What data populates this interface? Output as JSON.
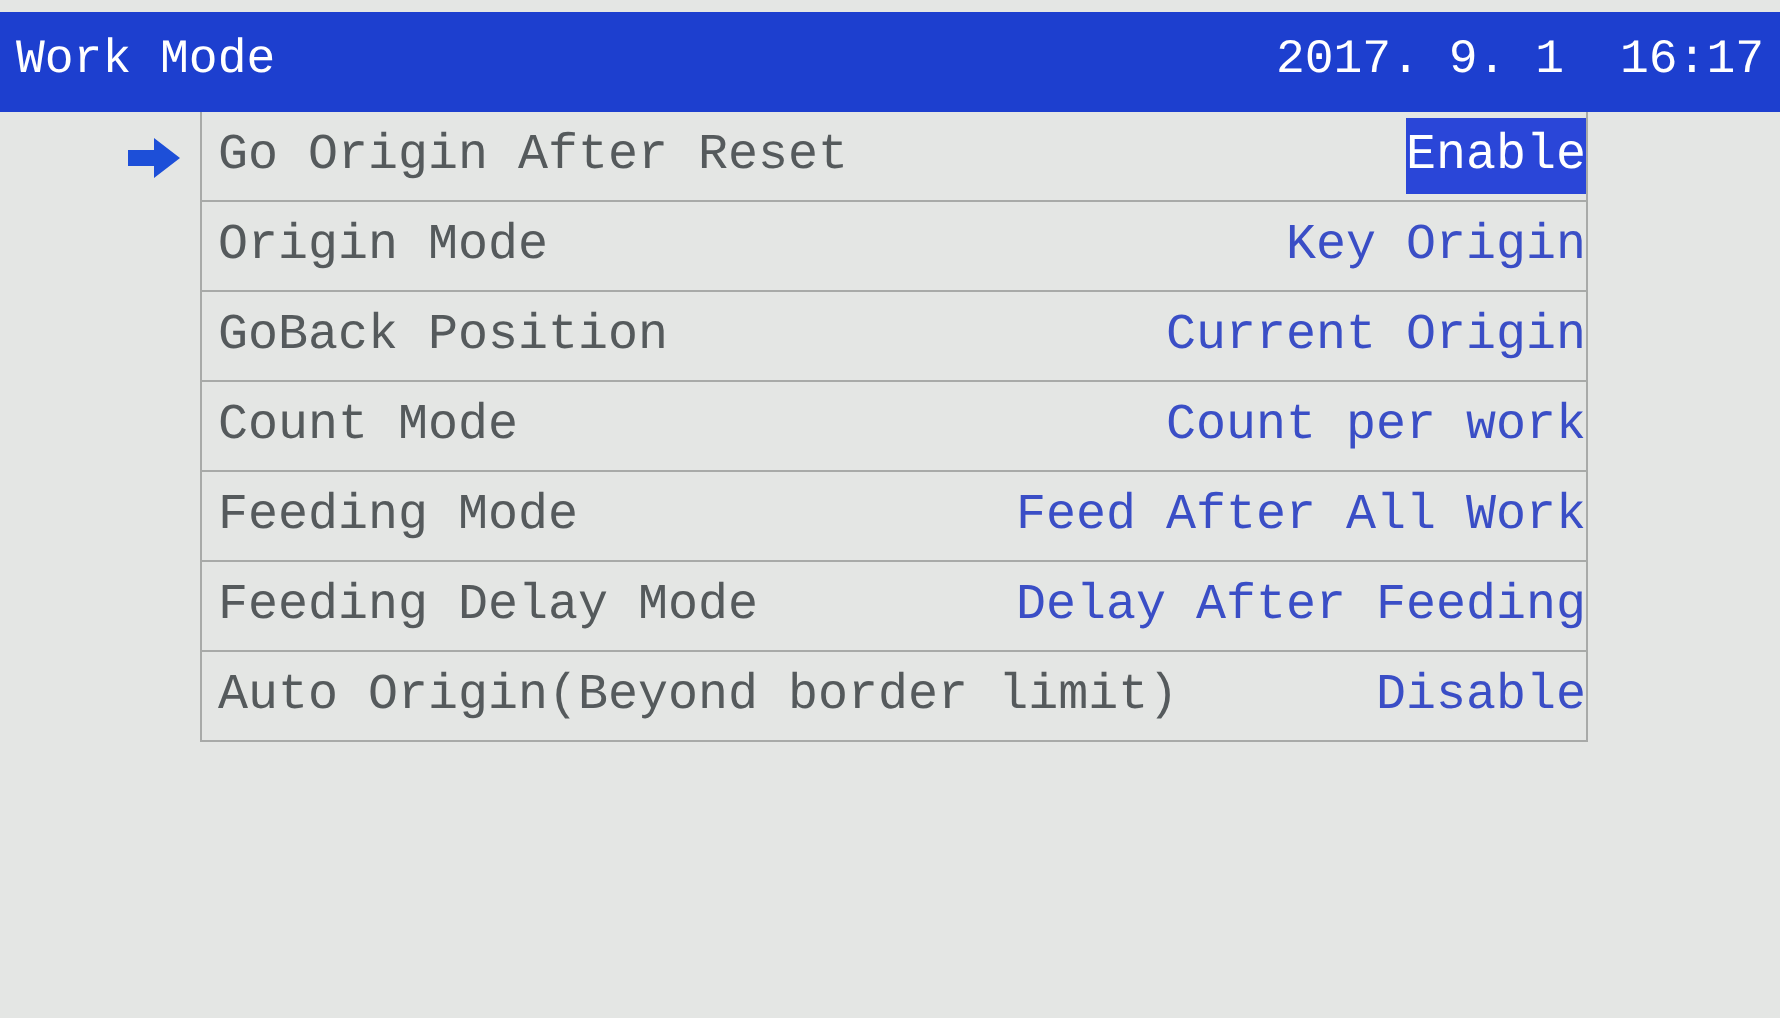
{
  "header": {
    "title": "Work Mode",
    "date": "2017. 9. 1",
    "time": "16:17"
  },
  "settings": [
    {
      "label": "Go Origin After Reset",
      "value": "Enable",
      "selected": true
    },
    {
      "label": "Origin Mode",
      "value": "Key Origin",
      "selected": false
    },
    {
      "label": "GoBack Position",
      "value": "Current Origin",
      "selected": false
    },
    {
      "label": "Count Mode",
      "value": "Count per work",
      "selected": false
    },
    {
      "label": "Feeding Mode",
      "value": "Feed After All Work",
      "selected": false
    },
    {
      "label": "Feeding Delay Mode",
      "value": "Delay After Feeding",
      "selected": false
    },
    {
      "label": "Auto Origin(Beyond border limit)",
      "value": "Disable",
      "selected": false
    }
  ]
}
